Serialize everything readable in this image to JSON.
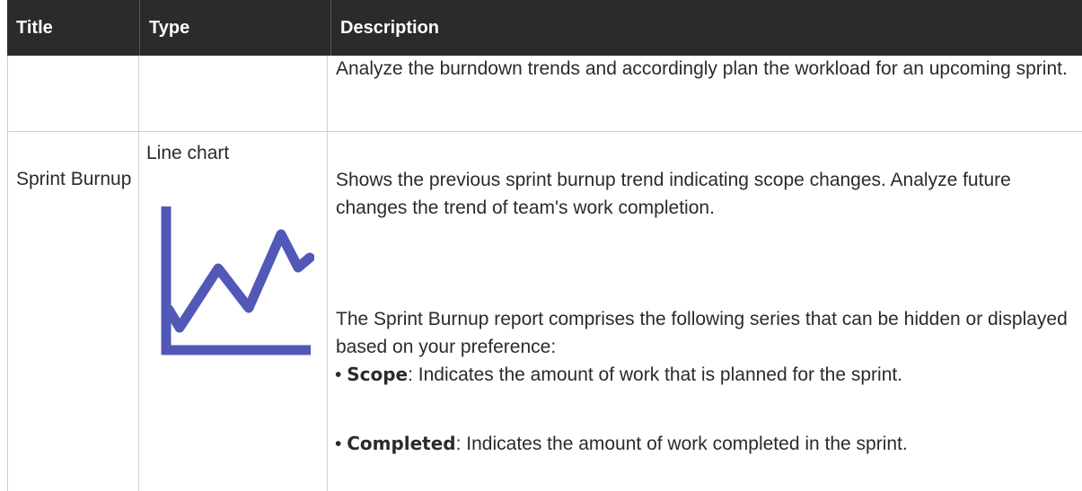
{
  "header": {
    "title": "Title",
    "type": "Type",
    "description": "Description"
  },
  "row1": {
    "description": "Analyze the burndown trends and accordingly plan the workload for an upcoming sprint."
  },
  "row2": {
    "title": "Sprint Burnup",
    "type": "Line chart",
    "type_icon": "line-chart-icon",
    "description_p1": "Shows the previous sprint burnup trend indicating scope changes. Analyze future changes the trend of team's work completion.",
    "description_p2": "The Sprint Burnup report comprises the following series that can be hidden or displayed based on your preference:",
    "bullets": [
      {
        "term": "Scope",
        "text": ": Indicates the amount of work that is planned for the sprint."
      },
      {
        "term": "Completed",
        "text": ": Indicates the amount of work completed in the sprint."
      }
    ]
  },
  "colors": {
    "header_bg": "#2b2b2b",
    "header_text": "#ffffff",
    "icon": "#5158b8",
    "rule": "#cfcfcf"
  }
}
